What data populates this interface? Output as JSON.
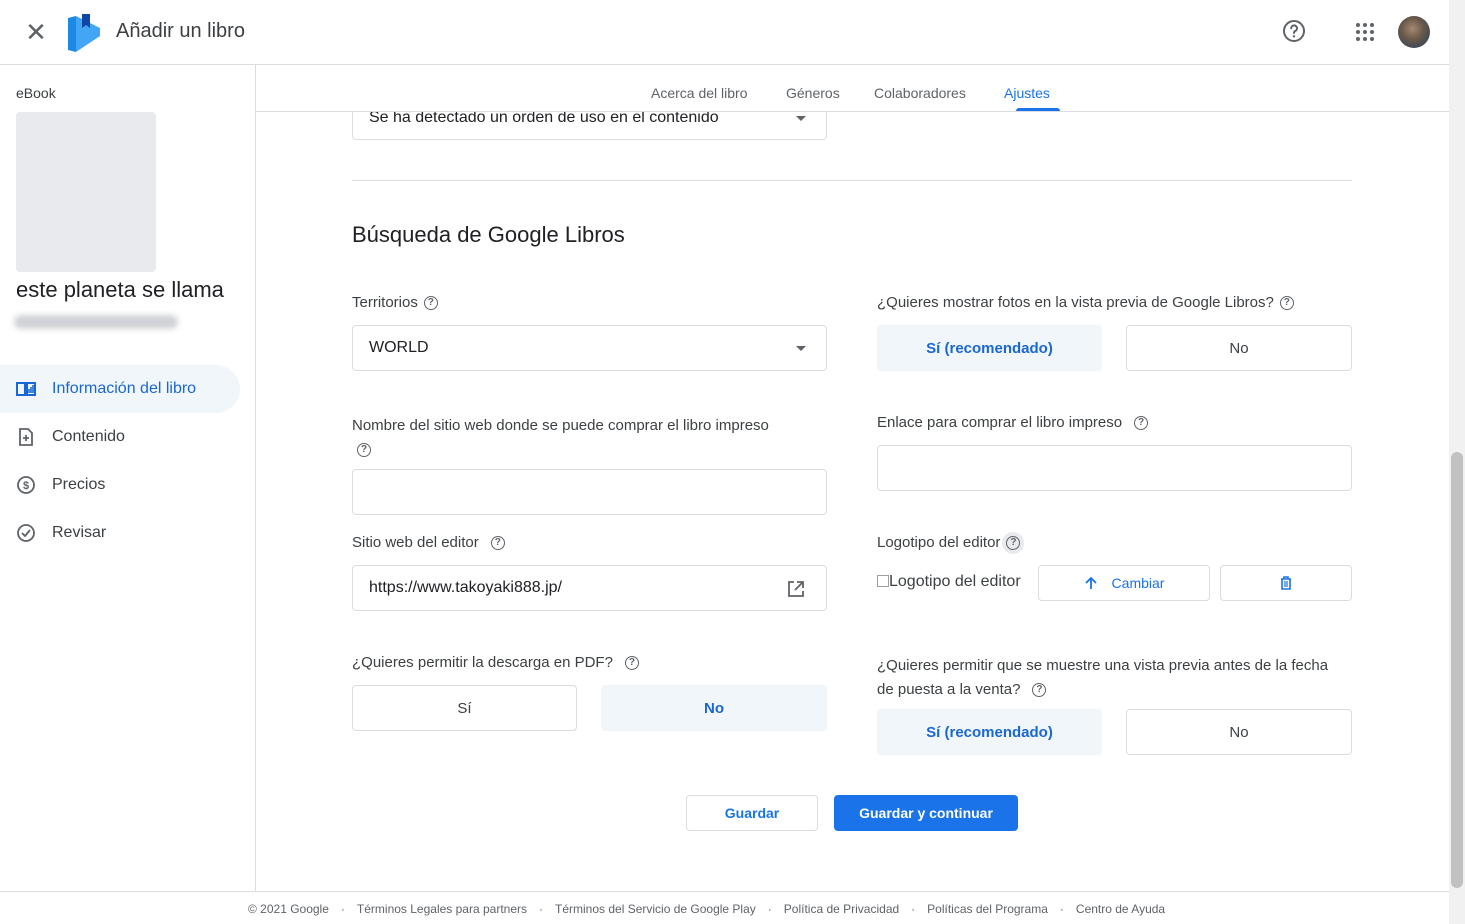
{
  "header": {
    "title": "Añadir un libro",
    "close_icon": "close-icon",
    "help_icon": "help-circle-icon",
    "apps_icon": "apps-grid-icon"
  },
  "sidebar": {
    "type_label": "eBook",
    "book_title": "este planeta se llama",
    "items": [
      {
        "label": "Información del libro",
        "icon": "book-info-icon",
        "active": true
      },
      {
        "label": "Contenido",
        "icon": "document-add-icon",
        "active": false
      },
      {
        "label": "Precios",
        "icon": "dollar-circle-icon",
        "active": false
      },
      {
        "label": "Revisar",
        "icon": "check-circle-icon",
        "active": false
      }
    ]
  },
  "tabs": [
    {
      "label": "Acerca del libro"
    },
    {
      "label": "Géneros"
    },
    {
      "label": "Colaboradores"
    },
    {
      "label": "Ajustes",
      "active": true
    }
  ],
  "form": {
    "top_select_value": "Se ha detectado un orden de uso en el contenido",
    "section_title": "Búsqueda de Google Libros",
    "territories": {
      "label": "Territorios",
      "value": "WORLD"
    },
    "photos_preview": {
      "label": "¿Quieres mostrar fotos en la vista previa de Google Libros?",
      "yes": "Sí (recomendado)",
      "no": "No",
      "selected": "yes"
    },
    "print_site_name": {
      "label": "Nombre del sitio web donde se puede comprar el libro impreso",
      "value": ""
    },
    "print_link": {
      "label": "Enlace para comprar el libro impreso",
      "value": ""
    },
    "publisher_site": {
      "label": "Sitio web del editor",
      "value": "https://www.takoyaki888.jp/"
    },
    "publisher_logo": {
      "label": "Logotipo del editor",
      "alt_text": "Logotipo del editor",
      "change_label": "Cambiar"
    },
    "pdf_download": {
      "label": "¿Quieres permitir la descarga en PDF?",
      "yes": "Sí",
      "no": "No",
      "selected": "no"
    },
    "pre_sale_preview": {
      "label": "¿Quieres permitir que se muestre una vista previa antes de la fecha de puesta a la venta?",
      "yes": "Sí (recomendado)",
      "no": "No",
      "selected": "yes"
    }
  },
  "actions": {
    "save": "Guardar",
    "save_continue": "Guardar y continuar"
  },
  "footer": {
    "copyright": "© 2021 Google",
    "links": [
      "Términos Legales para partners",
      "Términos del Servicio de Google Play",
      "Política de Privacidad",
      "Políticas del Programa",
      "Centro de Ayuda"
    ]
  },
  "colors": {
    "accent": "#1a73e8",
    "selected_bg": "#f1f6fb",
    "border": "#dadce0"
  }
}
